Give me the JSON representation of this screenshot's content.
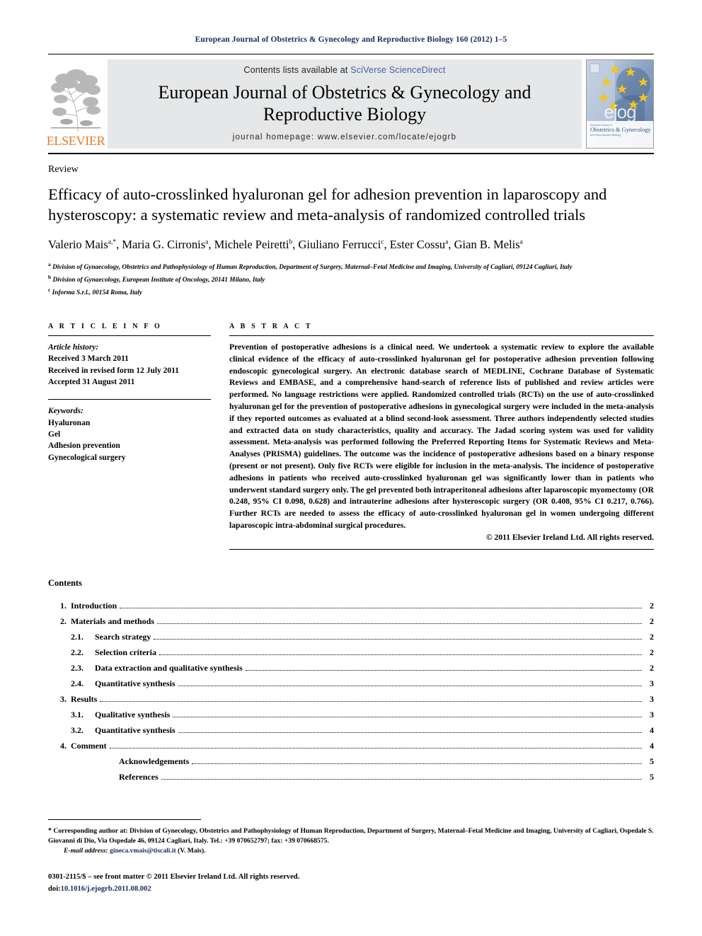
{
  "running_head": "European Journal of Obstetrics & Gynecology and Reproductive Biology 160 (2012) 1–5",
  "masthead": {
    "publisher_name": "ELSEVIER",
    "publisher_logo_icon": "elsevier-tree-icon",
    "contents_prefix": "Contents lists available at ",
    "contents_link": "SciVerse ScienceDirect",
    "journal_title_line1": "European Journal of Obstetrics & Gynecology and",
    "journal_title_line2": "Reproductive Biology",
    "homepage": "journal homepage: www.elsevier.com/locate/ejogrb",
    "cover_wordmark": "ejog",
    "cover_subtitle_line1": "Obstetrics & Gynecology",
    "cover_subtitle_line2": "and Reproductive Biology",
    "cover_topline": "European Journal of"
  },
  "article": {
    "doctype": "Review",
    "title": "Efficacy of auto-crosslinked hyaluronan gel for adhesion prevention in laparoscopy and hysteroscopy: a systematic review and meta-analysis of randomized controlled trials",
    "authors_html": "Valerio Mais, Maria G. Cirronis, Michele Peiretti, Giuliano Ferrucci, Ester Cossu, Gian B. Melis",
    "authors": [
      {
        "name": "Valerio Mais",
        "marks": "a,*"
      },
      {
        "name": "Maria G. Cirronis",
        "marks": "a"
      },
      {
        "name": "Michele Peiretti",
        "marks": "b"
      },
      {
        "name": "Giuliano Ferrucci",
        "marks": "c"
      },
      {
        "name": "Ester Cossu",
        "marks": "a"
      },
      {
        "name": "Gian B. Melis",
        "marks": "a"
      }
    ],
    "affiliations": [
      {
        "mark": "a",
        "text": "Division of Gynaecology, Obstetrics and Pathophysiology of Human Reproduction, Department of Surgery, Maternal–Fetal Medicine and Imaging, University of Cagliari, 09124 Cagliari, Italy"
      },
      {
        "mark": "b",
        "text": "Division of Gynaecology, European Institute of Oncology, 20141 Milano, Italy"
      },
      {
        "mark": "c",
        "text": "Informa S.r.l., 00154 Roma, Italy"
      }
    ]
  },
  "article_info": {
    "heading": "A R T I C L E   I N F O",
    "history_label": "Article history:",
    "history": [
      "Received 3 March 2011",
      "Received in revised form 12 July 2011",
      "Accepted 31 August 2011"
    ],
    "keywords_label": "Keywords:",
    "keywords": [
      "Hyaluronan",
      "Gel",
      "Adhesion prevention",
      "Gynecological surgery"
    ]
  },
  "abstract": {
    "heading": "A B S T R A C T",
    "body": "Prevention of postoperative adhesions is a clinical need. We undertook a systematic review to explore the available clinical evidence of the efficacy of auto-crosslinked hyaluronan gel for postoperative adhesion prevention following endoscopic gynecological surgery. An electronic database search of MEDLINE, Cochrane Database of Systematic Reviews and EMBASE, and a comprehensive hand-search of reference lists of published and review articles were performed. No language restrictions were applied. Randomized controlled trials (RCTs) on the use of auto-crosslinked hyaluronan gel for the prevention of postoperative adhesions in gynecological surgery were included in the meta-analysis if they reported outcomes as evaluated at a blind second-look assessment. Three authors independently selected studies and extracted data on study characteristics, quality and accuracy. The Jadad scoring system was used for validity assessment. Meta-analysis was performed following the Preferred Reporting Items for Systematic Reviews and Meta-Analyses (PRISMA) guidelines. The outcome was the incidence of postoperative adhesions based on a binary response (present or not present). Only five RCTs were eligible for inclusion in the meta-analysis. The incidence of postoperative adhesions in patients who received auto-crosslinked hyaluronan gel was significantly lower than in patients who underwent standard surgery only. The gel prevented both intraperitoneal adhesions after laparoscopic myomectomy (OR 0.248, 95% CI 0.098, 0.628) and intrauterine adhesions after hysteroscopic surgery (OR 0.408, 95% CI 0.217, 0.766). Further RCTs are needed to assess the efficacy of auto-crosslinked hyaluronan gel in women undergoing different laparoscopic intra-abdominal surgical procedures.",
    "copyright": "© 2011 Elsevier Ireland Ltd. All rights reserved."
  },
  "contents": {
    "heading": "Contents",
    "entries": [
      {
        "num": "1.",
        "subnum": "",
        "label": "Introduction",
        "page": "2",
        "level": 1
      },
      {
        "num": "2.",
        "subnum": "",
        "label": "Materials and methods",
        "page": "2",
        "level": 1
      },
      {
        "num": "",
        "subnum": "2.1.",
        "label": "Search strategy",
        "page": "2",
        "level": 2
      },
      {
        "num": "",
        "subnum": "2.2.",
        "label": "Selection criteria",
        "page": "2",
        "level": 2
      },
      {
        "num": "",
        "subnum": "2.3.",
        "label": "Data extraction and qualitative synthesis",
        "page": "2",
        "level": 2
      },
      {
        "num": "",
        "subnum": "2.4.",
        "label": "Quantitative synthesis",
        "page": "3",
        "level": 2
      },
      {
        "num": "3.",
        "subnum": "",
        "label": "Results",
        "page": "3",
        "level": 1
      },
      {
        "num": "",
        "subnum": "3.1.",
        "label": "Qualitative synthesis",
        "page": "3",
        "level": 2
      },
      {
        "num": "",
        "subnum": "3.2.",
        "label": "Quantitative synthesis",
        "page": "4",
        "level": 2
      },
      {
        "num": "4.",
        "subnum": "",
        "label": "Comment",
        "page": "4",
        "level": 1
      },
      {
        "num": "",
        "subnum": "",
        "label": "Acknowledgements",
        "page": "5",
        "level": 3
      },
      {
        "num": "",
        "subnum": "",
        "label": "References",
        "page": "5",
        "level": 3
      }
    ]
  },
  "footnote": {
    "star": "*",
    "corresponding": "Corresponding author at: Division of Gynecology, Obstetrics and Pathophysiology of Human Reproduction, Department of Surgery, Maternal–Fetal Medicine and Imaging, University of Cagliari, Ospedale S. Giovanni di Dio, Via Ospedale 46, 09124 Cagliari, Italy. Tel.: +39 070652797; fax: +39 070668575.",
    "email_label": "E-mail address:",
    "email": "gineca.vmais@tiscali.it",
    "email_suffix": "(V. Mais)."
  },
  "bottom": {
    "issn_line": "0301-2115/$ – see front matter © 2011 Elsevier Ireland Ltd. All rights reserved.",
    "doi_label": "doi:",
    "doi": "10.1016/j.ejogrb.2011.08.002"
  },
  "colors": {
    "running_head": "#1f2a63",
    "link_blue": "#4a5fa8",
    "elsevier_orange": "#e87722",
    "banner_gray": "#e6e7e8",
    "cover_blue": "#5a7aa8",
    "star_yellow": "#f5c518"
  }
}
